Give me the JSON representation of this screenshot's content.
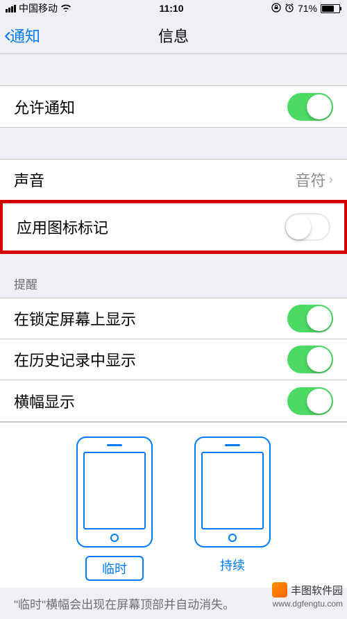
{
  "statusBar": {
    "carrier": "中国移动",
    "time": "11:10",
    "batteryPercent": "71%",
    "batteryFill": 71
  },
  "nav": {
    "back": "通知",
    "title": "信息"
  },
  "settings": {
    "allowNotifications": {
      "label": "允许通知",
      "on": true
    },
    "sound": {
      "label": "声音",
      "value": "音符"
    },
    "badge": {
      "label": "应用图标标记",
      "on": false
    }
  },
  "alerts": {
    "header": "提醒",
    "lockScreen": {
      "label": "在锁定屏幕上显示",
      "on": true
    },
    "history": {
      "label": "在历史记录中显示",
      "on": true
    },
    "banners": {
      "label": "横幅显示",
      "on": true
    }
  },
  "bannerStyle": {
    "temporary": "临时",
    "persistent": "持续"
  },
  "footer": "\"临时\"横幅会出现在屏幕顶部并自动消失。",
  "watermark": {
    "name": "丰图软件园",
    "url": "www.dgfengtu.com"
  }
}
